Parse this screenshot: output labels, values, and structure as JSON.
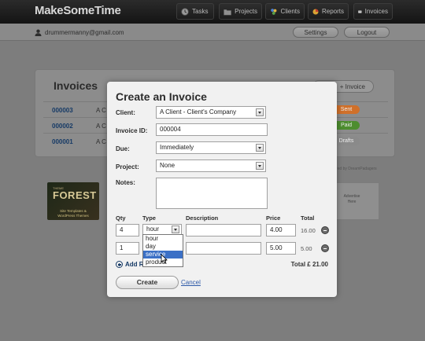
{
  "app": {
    "title": "MakeSomeTime"
  },
  "nav": {
    "tasks": "Tasks",
    "projects": "Projects",
    "clients": "Clients",
    "reports": "Reports",
    "invoices": "Invoices"
  },
  "user": {
    "email": "drummermanny@gmail.com"
  },
  "header_buttons": {
    "settings": "Settings",
    "logout": "Logout"
  },
  "invoices_page": {
    "heading": "Invoices",
    "new_invoice": "+ Invoice",
    "rows": [
      {
        "number": "000003",
        "client": "A C",
        "status": "Sent",
        "status_color": "#d0702a"
      },
      {
        "number": "000002",
        "client": "A C",
        "status": "Paid",
        "status_color": "#4d8d2f"
      },
      {
        "number": "000001",
        "client": "A C",
        "status": "Drafts",
        "status_color": "#8a8a8a"
      }
    ],
    "footer_note": "...ered by DreamPadagers"
  },
  "ads": {
    "forest_small": "THEME",
    "forest_big": "FOREST",
    "forest_line1": "Site Templates &",
    "forest_line2": "WordPress Themes",
    "slot_line1": "Advertise",
    "slot_line2": "Here"
  },
  "modal": {
    "title": "Create an Invoice",
    "client_label": "Client:",
    "client_value": "A Client - Client's Company",
    "invoice_id_label": "Invoice ID:",
    "invoice_id_value": "000004",
    "due_label": "Due:",
    "due_value": "Immediately",
    "project_label": "Project:",
    "project_value": "None",
    "notes_label": "Notes:",
    "columns": {
      "qty": "Qty",
      "type": "Type",
      "description": "Description",
      "price": "Price",
      "total": "Total"
    },
    "line_items": [
      {
        "qty": "4",
        "type": "hour",
        "description": "",
        "price": "4.00",
        "total": "16.00"
      },
      {
        "qty": "1",
        "type": "",
        "description": "",
        "price": "5.00",
        "total": "5.00"
      }
    ],
    "type_options": [
      "hour",
      "day",
      "service",
      "product"
    ],
    "type_highlighted": "service",
    "add_row": "Add R",
    "grand_total": "Total £ 21.00",
    "create": "Create",
    "cancel": "Cancel"
  }
}
